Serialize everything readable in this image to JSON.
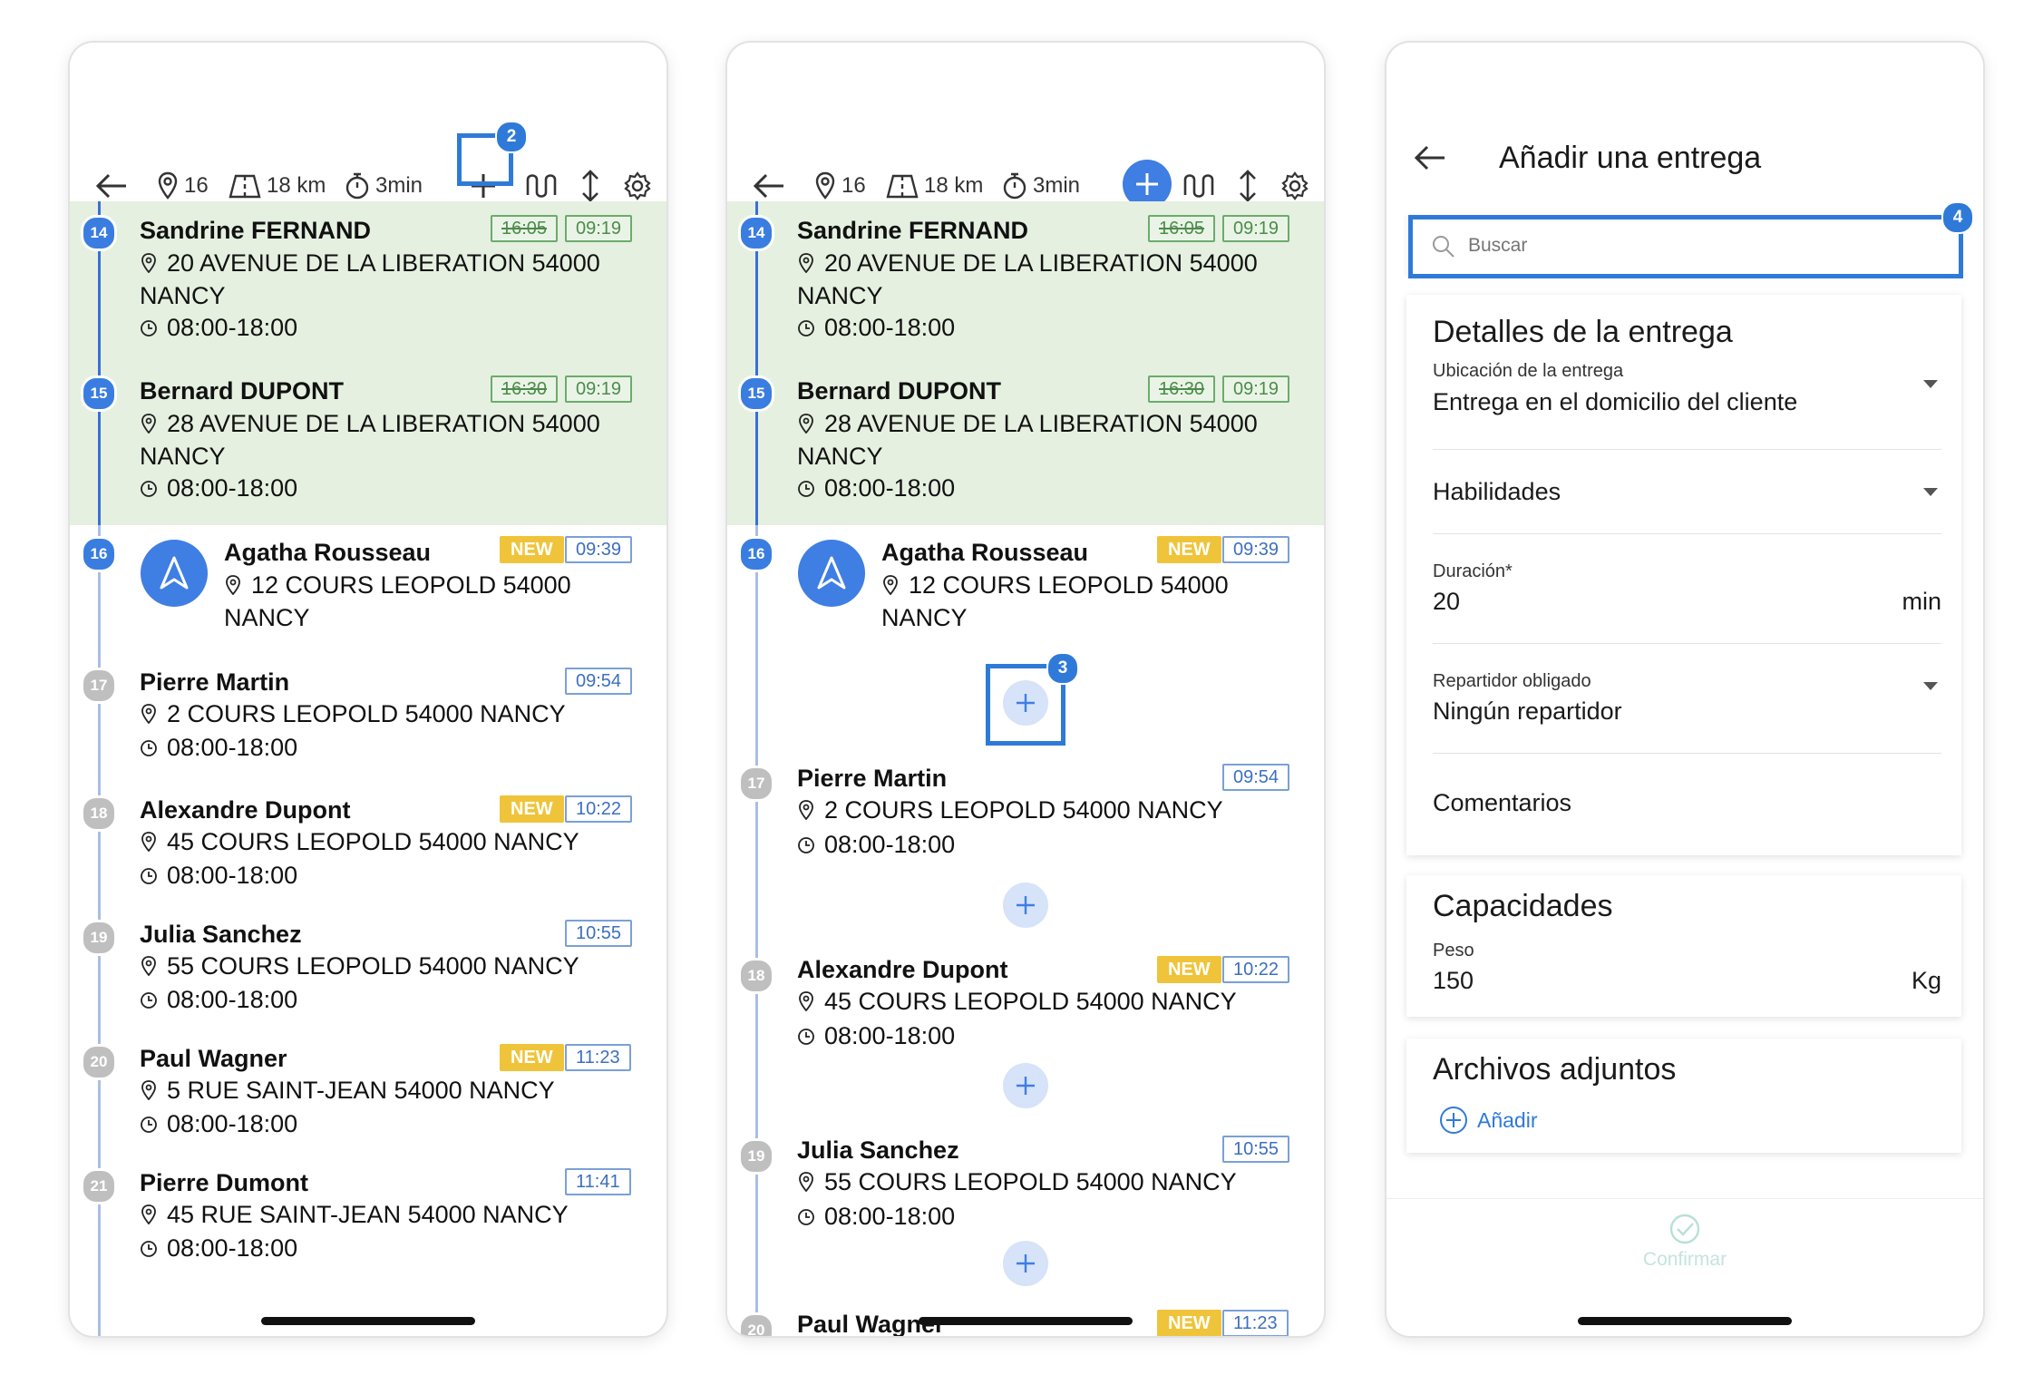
{
  "stats": {
    "stops": "16",
    "distance": "18 km",
    "duration": "3min"
  },
  "stops": [
    {
      "num": "14",
      "name": "Sandrine FERNAND",
      "addr1": "20 AVENUE DE LA LIBERATION 54000",
      "addr2": "NANCY",
      "hours": "08:00-18:00",
      "old": "16:05",
      "eta": "09:19"
    },
    {
      "num": "15",
      "name": "Bernard DUPONT",
      "addr1": "28 AVENUE DE LA LIBERATION 54000",
      "addr2": "NANCY",
      "hours": "08:00-18:00",
      "old": "16:30",
      "eta": "09:19"
    },
    {
      "num": "16",
      "name": "Agatha Rousseau",
      "addr1": "12 COURS LEOPOLD 54000",
      "addr2": "NANCY",
      "new": "NEW",
      "eta": "09:39"
    },
    {
      "num": "17",
      "name": "Pierre Martin",
      "addr1": "2 COURS LEOPOLD 54000 NANCY",
      "hours": "08:00-18:00",
      "eta": "09:54"
    },
    {
      "num": "18",
      "name": "Alexandre Dupont",
      "addr1": "45 COURS LEOPOLD 54000 NANCY",
      "hours": "08:00-18:00",
      "new": "NEW",
      "eta": "10:22"
    },
    {
      "num": "19",
      "name": "Julia Sanchez",
      "addr1": "55 COURS LEOPOLD 54000 NANCY",
      "hours": "08:00-18:00",
      "eta": "10:55"
    },
    {
      "num": "20",
      "name": "Paul Wagner",
      "addr1": "5 RUE SAINT-JEAN 54000 NANCY",
      "hours": "08:00-18:00",
      "new": "NEW",
      "eta": "11:23"
    },
    {
      "num": "21",
      "name": "Pierre Dumont",
      "addr1": "45 RUE SAINT-JEAN 54000 NANCY",
      "hours": "08:00-18:00",
      "eta": "11:41"
    }
  ],
  "markers": {
    "m2": "2",
    "m3": "3",
    "m4": "4"
  },
  "form": {
    "title": "Añadir una entrega",
    "search_placeholder": "Buscar",
    "details_title": "Detalles de la entrega",
    "location_label": "Ubicación de la entrega",
    "location_value": "Entrega en el domicilio del cliente",
    "skills_label": "Habilidades",
    "duration_label": "Duración*",
    "duration_value": "20",
    "duration_unit": "min",
    "driver_label": "Repartidor obligado",
    "driver_value": "Ningún repartidor",
    "comments_label": "Comentarios",
    "capacities_title": "Capacidades",
    "weight_label": "Peso",
    "weight_value": "150",
    "weight_unit": "Kg",
    "attachments_title": "Archivos adjuntos",
    "add_label": "Añadir",
    "confirm_label": "Confirmar"
  },
  "colors": {
    "accent": "#2f7ad8",
    "done_bg": "#e5f0e0",
    "new_badge": "#efc43a"
  }
}
